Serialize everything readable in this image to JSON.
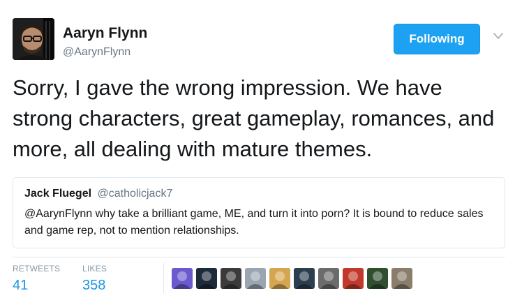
{
  "author": {
    "name": "Aaryn Flynn",
    "handle": "@AarynFlynn",
    "follow_label": "Following"
  },
  "tweet": {
    "text": "Sorry, I gave the wrong impression. We have strong characters, great gameplay, romances, and more, all dealing with mature themes."
  },
  "quoted": {
    "name": "Jack Fluegel",
    "handle": "@catholicjack7",
    "text": "@AarynFlynn why take a brilliant game, ME, and turn it into porn? It is bound to reduce sales and game rep, not to mention relationships."
  },
  "stats": {
    "retweets_label": "RETWEETS",
    "retweets_value": "41",
    "likes_label": "LIKES",
    "likes_value": "358"
  },
  "likers": [
    {
      "name": "liker-avatar-1",
      "bg": "#6a5acd"
    },
    {
      "name": "liker-avatar-2",
      "bg": "#1c2a3a"
    },
    {
      "name": "liker-avatar-3",
      "bg": "#3b3b3b"
    },
    {
      "name": "liker-avatar-4",
      "bg": "#9aa5b1"
    },
    {
      "name": "liker-avatar-5",
      "bg": "#d4a650"
    },
    {
      "name": "liker-avatar-6",
      "bg": "#2c3e50"
    },
    {
      "name": "liker-avatar-7",
      "bg": "#6b6b6b"
    },
    {
      "name": "liker-avatar-8",
      "bg": "#c0392b"
    },
    {
      "name": "liker-avatar-9",
      "bg": "#2f4f2f"
    },
    {
      "name": "liker-avatar-10",
      "bg": "#8b7d6b"
    }
  ],
  "colors": {
    "accent": "#1da1f2",
    "stat_value": "#1b95e0",
    "muted": "#657786"
  }
}
